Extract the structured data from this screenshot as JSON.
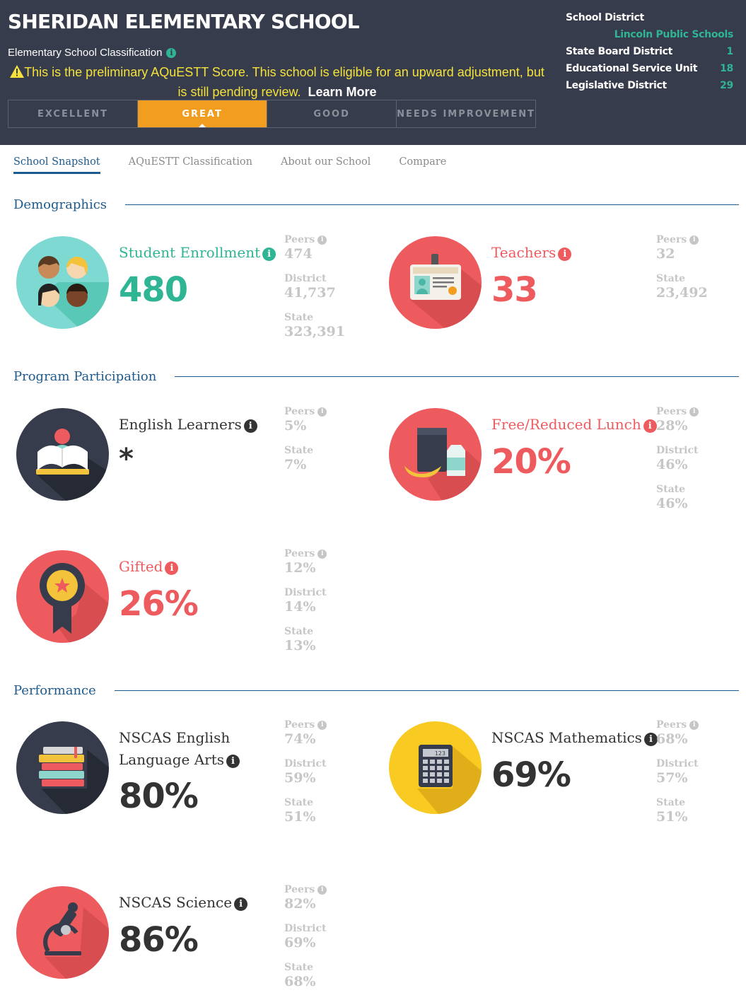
{
  "header": {
    "school_name": "SHERIDAN ELEMENTARY SCHOOL",
    "classification_label": "Elementary School Classification",
    "warning_text": "This is the preliminary AQuESTT Score. This school is eligible for an upward adjustment, but is still pending review.",
    "learn_more": "Learn More",
    "ratings": [
      "EXCELLENT",
      "GREAT",
      "GOOD",
      "NEEDS IMPROVEMENT"
    ],
    "active_rating": "GREAT",
    "district": {
      "school_district_label": "School District",
      "school_district_value": "Lincoln Public Schools",
      "state_board_label": "State Board District",
      "state_board_value": "1",
      "esu_label": "Educational Service Unit",
      "esu_value": "18",
      "legislative_label": "Legislative District",
      "legislative_value": "29"
    }
  },
  "tabs": [
    "School Snapshot",
    "AQuESTT Classification",
    "About our School",
    "Compare"
  ],
  "active_tab": "School Snapshot",
  "sections": {
    "demographics": "Demographics",
    "program": "Program Participation",
    "performance": "Performance"
  },
  "info_glyph": "i",
  "stats": {
    "enrollment": {
      "label": "Student Enrollment",
      "value": "480",
      "compare": [
        {
          "label": "Peers",
          "value": "474"
        },
        {
          "label": "District",
          "value": "41,737"
        },
        {
          "label": "State",
          "value": "323,391"
        }
      ]
    },
    "teachers": {
      "label": "Teachers",
      "value": "33",
      "compare": [
        {
          "label": "Peers",
          "value": "32"
        },
        {
          "label": "State",
          "value": "23,492"
        }
      ]
    },
    "english_learners": {
      "label": "English Learners",
      "value": "*",
      "compare": [
        {
          "label": "Peers",
          "value": "5%"
        },
        {
          "label": "State",
          "value": "7%"
        }
      ]
    },
    "lunch": {
      "label": "Free/Reduced Lunch",
      "value": "20%",
      "compare": [
        {
          "label": "Peers",
          "value": "28%"
        },
        {
          "label": "District",
          "value": "46%"
        },
        {
          "label": "State",
          "value": "46%"
        }
      ]
    },
    "gifted": {
      "label": "Gifted",
      "value": "26%",
      "compare": [
        {
          "label": "Peers",
          "value": "12%"
        },
        {
          "label": "District",
          "value": "14%"
        },
        {
          "label": "State",
          "value": "13%"
        }
      ]
    },
    "ela": {
      "label_line1": "NSCAS English",
      "label_line2": "Language Arts",
      "value": "80%",
      "compare": [
        {
          "label": "Peers",
          "value": "74%"
        },
        {
          "label": "District",
          "value": "59%"
        },
        {
          "label": "State",
          "value": "51%"
        }
      ]
    },
    "math": {
      "label": "NSCAS Mathematics",
      "value": "69%",
      "calc_display": "123",
      "compare": [
        {
          "label": "Peers",
          "value": "68%"
        },
        {
          "label": "District",
          "value": "57%"
        },
        {
          "label": "State",
          "value": "51%"
        }
      ]
    },
    "science": {
      "label": "NSCAS Science",
      "value": "86%",
      "compare": [
        {
          "label": "Peers",
          "value": "82%"
        },
        {
          "label": "District",
          "value": "69%"
        },
        {
          "label": "State",
          "value": "68%"
        }
      ]
    }
  },
  "colors": {
    "header_bg": "#363c4b",
    "accent_teal": "#2fb494",
    "accent_red": "#ee5b5e",
    "rating_active": "#f19d1f",
    "warning_yellow": "#f4e23b",
    "link_blue": "#1d5b8f",
    "compare_gray": "#c6c6c6"
  },
  "icons": {
    "enrollment": "students-icon",
    "teachers": "id-badge-icon",
    "english_learners": "reader-book-icon",
    "lunch": "lunch-bag-icon",
    "gifted": "award-ribbon-icon",
    "ela": "book-stack-icon",
    "math": "calculator-icon",
    "science": "microscope-icon"
  }
}
